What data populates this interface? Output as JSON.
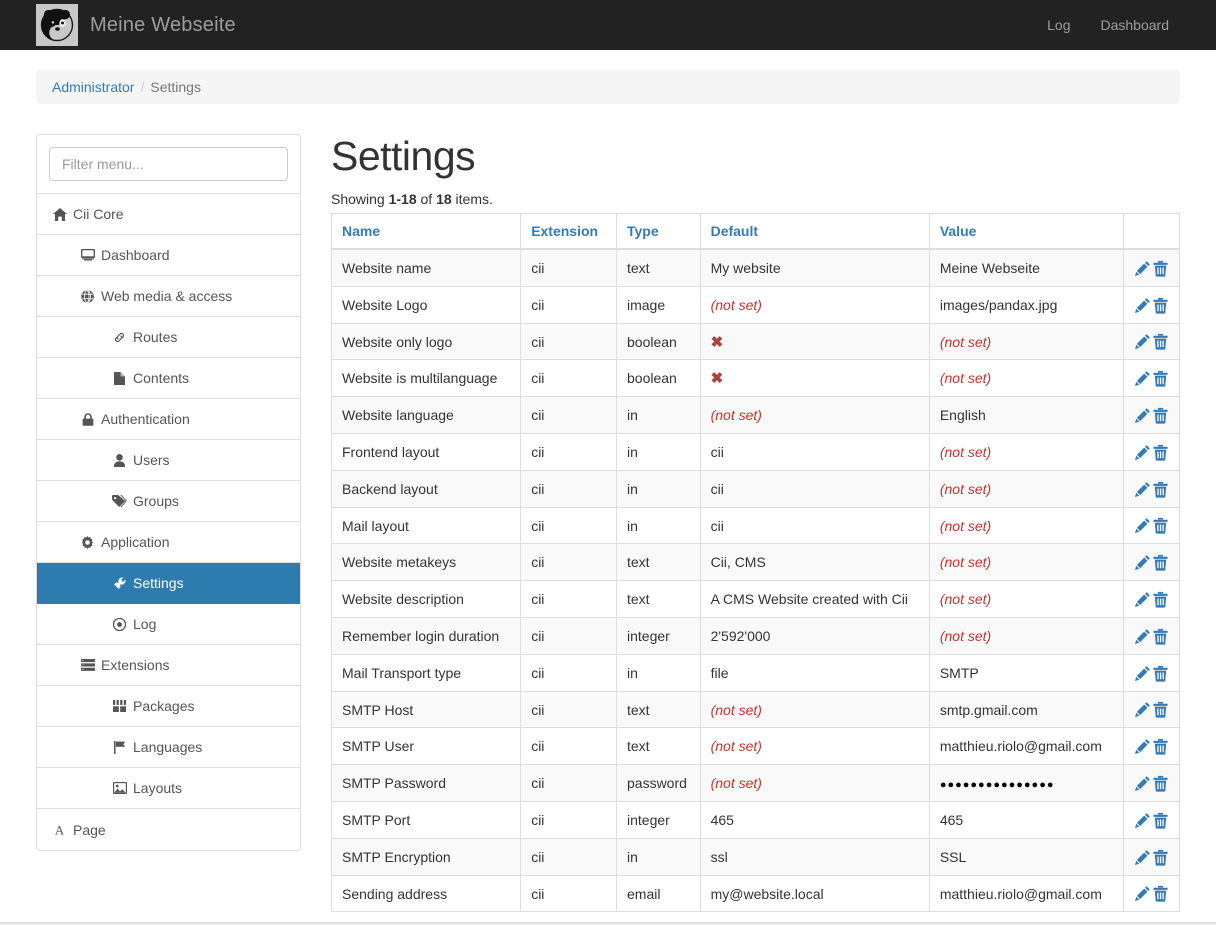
{
  "navbar": {
    "logo_icon": "panda-logo-icon",
    "brand": "Meine Webseite",
    "links": [
      {
        "label": "Log",
        "name": "nav-link-log"
      },
      {
        "label": "Dashboard",
        "name": "nav-link-dashboard"
      }
    ]
  },
  "breadcrumb": {
    "root": "Administrator",
    "separator": "/",
    "current": "Settings"
  },
  "sidebar": {
    "filter_placeholder": "Filter menu...",
    "filter_value": "",
    "items": [
      {
        "label": "Cii Core",
        "icon": "home-icon",
        "level": 0,
        "active": false
      },
      {
        "label": "Dashboard",
        "icon": "desktop-icon",
        "level": 1,
        "active": false
      },
      {
        "label": "Web media & access",
        "icon": "globe-icon",
        "level": 1,
        "active": false
      },
      {
        "label": "Routes",
        "icon": "link-icon",
        "level": 2,
        "active": false
      },
      {
        "label": "Contents",
        "icon": "file-icon",
        "level": 2,
        "active": false
      },
      {
        "label": "Authentication",
        "icon": "lock-icon",
        "level": 1,
        "active": false
      },
      {
        "label": "Users",
        "icon": "user-icon",
        "level": 2,
        "active": false
      },
      {
        "label": "Groups",
        "icon": "tag-icon",
        "level": 2,
        "active": false
      },
      {
        "label": "Application",
        "icon": "gear-icon",
        "level": 1,
        "active": false
      },
      {
        "label": "Settings",
        "icon": "wrench-icon",
        "level": 2,
        "active": true
      },
      {
        "label": "Log",
        "icon": "clock-icon",
        "level": 2,
        "active": false
      },
      {
        "label": "Extensions",
        "icon": "server-icon",
        "level": 1,
        "active": false
      },
      {
        "label": "Packages",
        "icon": "th-large-icon",
        "level": 2,
        "active": false
      },
      {
        "label": "Languages",
        "icon": "flag-icon",
        "level": 2,
        "active": false
      },
      {
        "label": "Layouts",
        "icon": "picture-icon",
        "level": 2,
        "active": false
      },
      {
        "label": "Page",
        "icon": "font-icon",
        "level": 0,
        "active": false
      }
    ]
  },
  "main": {
    "title": "Settings",
    "summary_prefix": "Showing ",
    "summary_range": "1-18",
    "summary_mid": " of ",
    "summary_total": "18",
    "summary_suffix": " items.",
    "columns": [
      "Name",
      "Extension",
      "Type",
      "Default",
      "Value",
      ""
    ],
    "row_actions": {
      "edit": "pencil-icon",
      "delete": "trash-icon"
    },
    "rows": [
      {
        "name": "Website name",
        "extension": "cii",
        "type": "text",
        "default": "My website",
        "default_kind": "text",
        "value": "Meine Webseite",
        "value_kind": "text"
      },
      {
        "name": "Website Logo",
        "extension": "cii",
        "type": "image",
        "default": "(not set)",
        "default_kind": "notset",
        "value": "images/pandax.jpg",
        "value_kind": "text"
      },
      {
        "name": "Website only logo",
        "extension": "cii",
        "type": "boolean",
        "default": "✖",
        "default_kind": "xmark",
        "value": "(not set)",
        "value_kind": "notset"
      },
      {
        "name": "Website is multilanguage",
        "extension": "cii",
        "type": "boolean",
        "default": "✖",
        "default_kind": "xmark",
        "value": "(not set)",
        "value_kind": "notset"
      },
      {
        "name": "Website language",
        "extension": "cii",
        "type": "in",
        "default": "(not set)",
        "default_kind": "notset",
        "value": "English",
        "value_kind": "text"
      },
      {
        "name": "Frontend layout",
        "extension": "cii",
        "type": "in",
        "default": "cii",
        "default_kind": "text",
        "value": "(not set)",
        "value_kind": "notset"
      },
      {
        "name": "Backend layout",
        "extension": "cii",
        "type": "in",
        "default": "cii",
        "default_kind": "text",
        "value": "(not set)",
        "value_kind": "notset"
      },
      {
        "name": "Mail layout",
        "extension": "cii",
        "type": "in",
        "default": "cii",
        "default_kind": "text",
        "value": "(not set)",
        "value_kind": "notset"
      },
      {
        "name": "Website metakeys",
        "extension": "cii",
        "type": "text",
        "default": "Cii, CMS",
        "default_kind": "text",
        "value": "(not set)",
        "value_kind": "notset"
      },
      {
        "name": "Website description",
        "extension": "cii",
        "type": "text",
        "default": "A CMS Website created with Cii",
        "default_kind": "text",
        "value": "(not set)",
        "value_kind": "notset"
      },
      {
        "name": "Remember login duration",
        "extension": "cii",
        "type": "integer",
        "default": "2'592'000",
        "default_kind": "text",
        "value": "(not set)",
        "value_kind": "notset"
      },
      {
        "name": "Mail Transport type",
        "extension": "cii",
        "type": "in",
        "default": "file",
        "default_kind": "text",
        "value": "SMTP",
        "value_kind": "text"
      },
      {
        "name": "SMTP Host",
        "extension": "cii",
        "type": "text",
        "default": "(not set)",
        "default_kind": "notset",
        "value": "smtp.gmail.com",
        "value_kind": "text"
      },
      {
        "name": "SMTP User",
        "extension": "cii",
        "type": "text",
        "default": "(not set)",
        "default_kind": "notset",
        "value": "matthieu.riolo@gmail.com",
        "value_kind": "text"
      },
      {
        "name": "SMTP Password",
        "extension": "cii",
        "type": "password",
        "default": "(not set)",
        "default_kind": "notset",
        "value": "●●●●●●●●●●●●●●●",
        "value_kind": "dots"
      },
      {
        "name": "SMTP Port",
        "extension": "cii",
        "type": "integer",
        "default": "465",
        "default_kind": "text",
        "value": "465",
        "value_kind": "text"
      },
      {
        "name": "SMTP Encryption",
        "extension": "cii",
        "type": "in",
        "default": "ssl",
        "default_kind": "text",
        "value": "SSL",
        "value_kind": "text"
      },
      {
        "name": "Sending address",
        "extension": "cii",
        "type": "email",
        "default": "my@website.local",
        "default_kind": "text",
        "value": "matthieu.riolo@gmail.com",
        "value_kind": "text"
      }
    ]
  },
  "colors": {
    "navbar_bg": "#222222",
    "link": "#337ab7",
    "active_menu": "#2c7cb0",
    "danger": "#c9302c",
    "xmark": "#a94442"
  }
}
